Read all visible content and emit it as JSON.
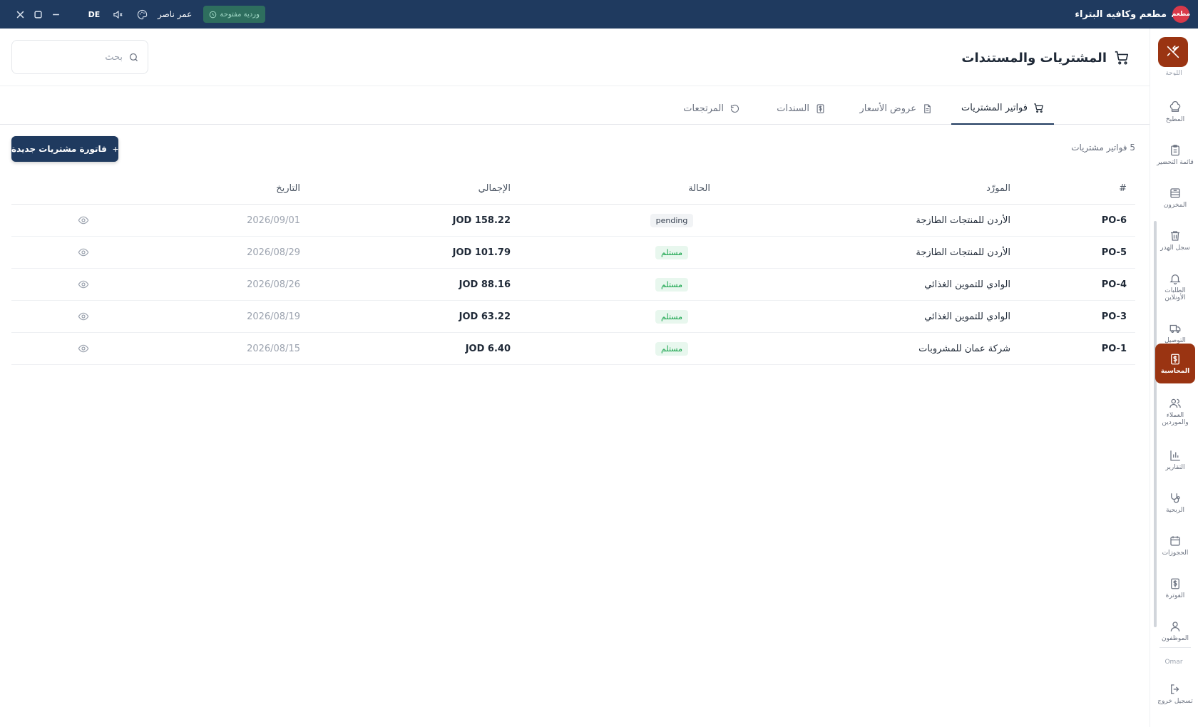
{
  "app": {
    "name": "مطعم وكافيه البتراء",
    "logo_text": "مطعم",
    "user_name": "عمر ناصر",
    "shift_label": "وردية مفتوحة",
    "language": "DE"
  },
  "sidebar": {
    "cut_label": "اللوحة",
    "items": [
      {
        "label": "المطبخ",
        "icon": "chef-hat-icon"
      },
      {
        "label": "قائمة التحضير",
        "icon": "clipboard-icon"
      },
      {
        "label": "المخزون",
        "icon": "inventory-icon"
      },
      {
        "label": "سجل الهدر",
        "icon": "trash-icon"
      },
      {
        "label": "الطلبات الأونلاين",
        "icon": "bell-icon"
      },
      {
        "label": "التوصيل",
        "icon": "truck-icon"
      },
      {
        "label": "المحاسبة",
        "icon": "dollar-doc-icon",
        "active": true
      },
      {
        "label": "العملاء والموردين",
        "icon": "users-icon"
      },
      {
        "label": "التقارير",
        "icon": "bar-chart-icon"
      },
      {
        "label": "الربحية",
        "icon": "stethoscope-icon"
      },
      {
        "label": "الحجوزات",
        "icon": "calendar-icon"
      },
      {
        "label": "الفوترة",
        "icon": "invoice-icon"
      },
      {
        "label": "الموظفون",
        "icon": "user-icon"
      }
    ],
    "user_short": "Omar",
    "logout_label": "تسجيل خروج"
  },
  "header": {
    "title": "المشتريات والمستندات",
    "search_placeholder": "بحث"
  },
  "tabs": [
    {
      "label": "فواتير المشتريات",
      "icon": "cart-icon",
      "active": true
    },
    {
      "label": "عروض الأسعار",
      "icon": "document-icon"
    },
    {
      "label": "السندات",
      "icon": "receipt-icon"
    },
    {
      "label": "المرتجعات",
      "icon": "rotate-icon"
    }
  ],
  "toolbar": {
    "count_label": "5 فواتير مشتريات",
    "new_button": "فاتورة مشتريات جديدة"
  },
  "table": {
    "columns": {
      "number": "#",
      "supplier": "المورّد",
      "status": "الحالة",
      "total": "الإجمالي",
      "date": "التاريخ"
    },
    "rows": [
      {
        "number": "PO-6",
        "supplier": "الأردن للمنتجات الطازجة",
        "status": "pending",
        "status_type": "pending",
        "total": "JOD 158.22",
        "date": "2026/09/01"
      },
      {
        "number": "PO-5",
        "supplier": "الأردن للمنتجات الطازجة",
        "status": "مستلم",
        "status_type": "received",
        "total": "JOD 101.79",
        "date": "2026/08/29"
      },
      {
        "number": "PO-4",
        "supplier": "الوادي للتموين الغذائي",
        "status": "مستلم",
        "status_type": "received",
        "total": "JOD 88.16",
        "date": "2026/08/26"
      },
      {
        "number": "PO-3",
        "supplier": "الوادي للتموين الغذائي",
        "status": "مستلم",
        "status_type": "received",
        "total": "JOD 63.22",
        "date": "2026/08/19"
      },
      {
        "number": "PO-1",
        "supplier": "شركة عمان للمشروبات",
        "status": "مستلم",
        "status_type": "received",
        "total": "JOD 6.40",
        "date": "2026/08/15"
      }
    ]
  },
  "colors": {
    "topbar": "#1f3a5f",
    "accent": "#9a3412",
    "primary_button": "#1f3a5f",
    "received": "#16a34a"
  }
}
